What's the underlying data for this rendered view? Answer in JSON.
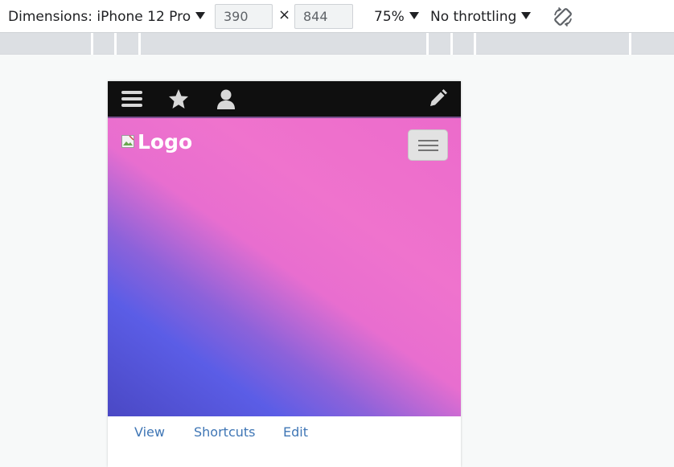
{
  "toolbar": {
    "dimensions_label": "Dimensions: iPhone 12 Pro",
    "width_value": "390",
    "height_value": "844",
    "times_symbol": "×",
    "zoom_label": "75%",
    "throttling_label": "No throttling",
    "rotate_icon": "rotate-icon"
  },
  "device": {
    "admin_bar": {
      "icons": [
        "menu-icon",
        "star-icon",
        "user-icon",
        "pencil-icon"
      ]
    },
    "logo_text": "Logo",
    "menu_toggle_icon": "hamburger-icon",
    "tabs": [
      {
        "label": "View"
      },
      {
        "label": "Shortcuts"
      },
      {
        "label": "Edit"
      }
    ]
  },
  "colors": {
    "admin_bar_bg": "#0f0f0f",
    "gradient_pink": "#ef73cd",
    "gradient_blue": "#5b5de6",
    "tab_link": "#3f76b5"
  }
}
